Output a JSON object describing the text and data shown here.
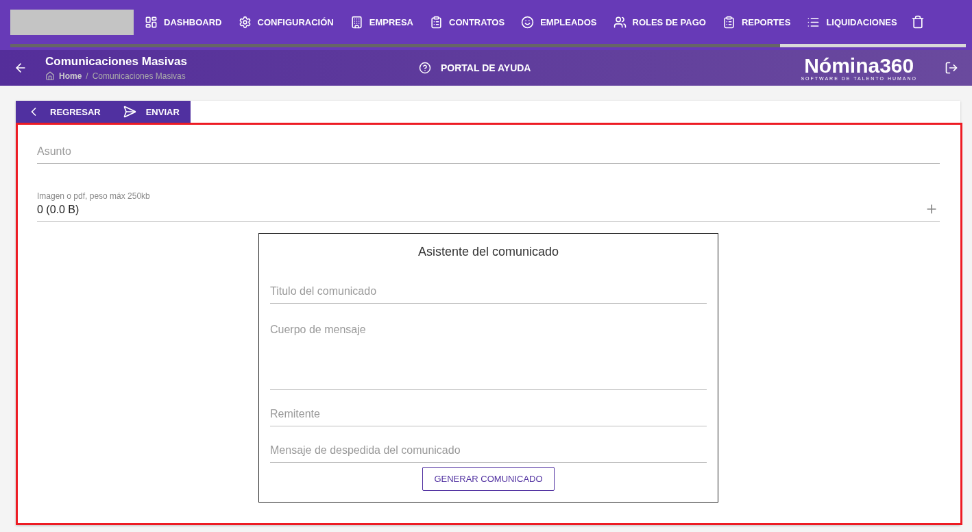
{
  "nav": {
    "items": [
      {
        "label": "DASHBOARD"
      },
      {
        "label": "CONFIGURACIÓN"
      },
      {
        "label": "EMPRESA"
      },
      {
        "label": "CONTRATOS"
      },
      {
        "label": "EMPLEADOS"
      },
      {
        "label": "ROLES DE PAGO"
      },
      {
        "label": "REPORTES"
      },
      {
        "label": "LIQUIDACIONES"
      }
    ]
  },
  "header": {
    "title": "Comunicaciones Masivas",
    "breadcrumb": [
      "Home",
      "Comunicaciones Masivas"
    ],
    "separator": "/",
    "help": "PORTAL DE AYUDA",
    "brand": "Nómina360",
    "tagline": "SOFTWARE DE TALENTO HUMANO"
  },
  "toolbar": [
    {
      "label": "REGRESAR"
    },
    {
      "label": "ENVIAR"
    }
  ],
  "form": {
    "subject": {
      "placeholder": "Asunto"
    },
    "attachment": {
      "label": "Imagen o pdf, peso máx 250kb",
      "value": "0 (0.0 B)"
    }
  },
  "wizard": {
    "title": "Asistente del comunicado",
    "fields": [
      {
        "placeholder": "Titulo del comunicado",
        "kind": "line"
      },
      {
        "placeholder": "Cuerpo de mensaje",
        "kind": "area"
      },
      {
        "placeholder": "Remitente",
        "kind": "line"
      },
      {
        "placeholder": "Mensaje de despedida del comunicado",
        "kind": "line"
      }
    ],
    "button": "GENERAR COMUNICADO"
  }
}
